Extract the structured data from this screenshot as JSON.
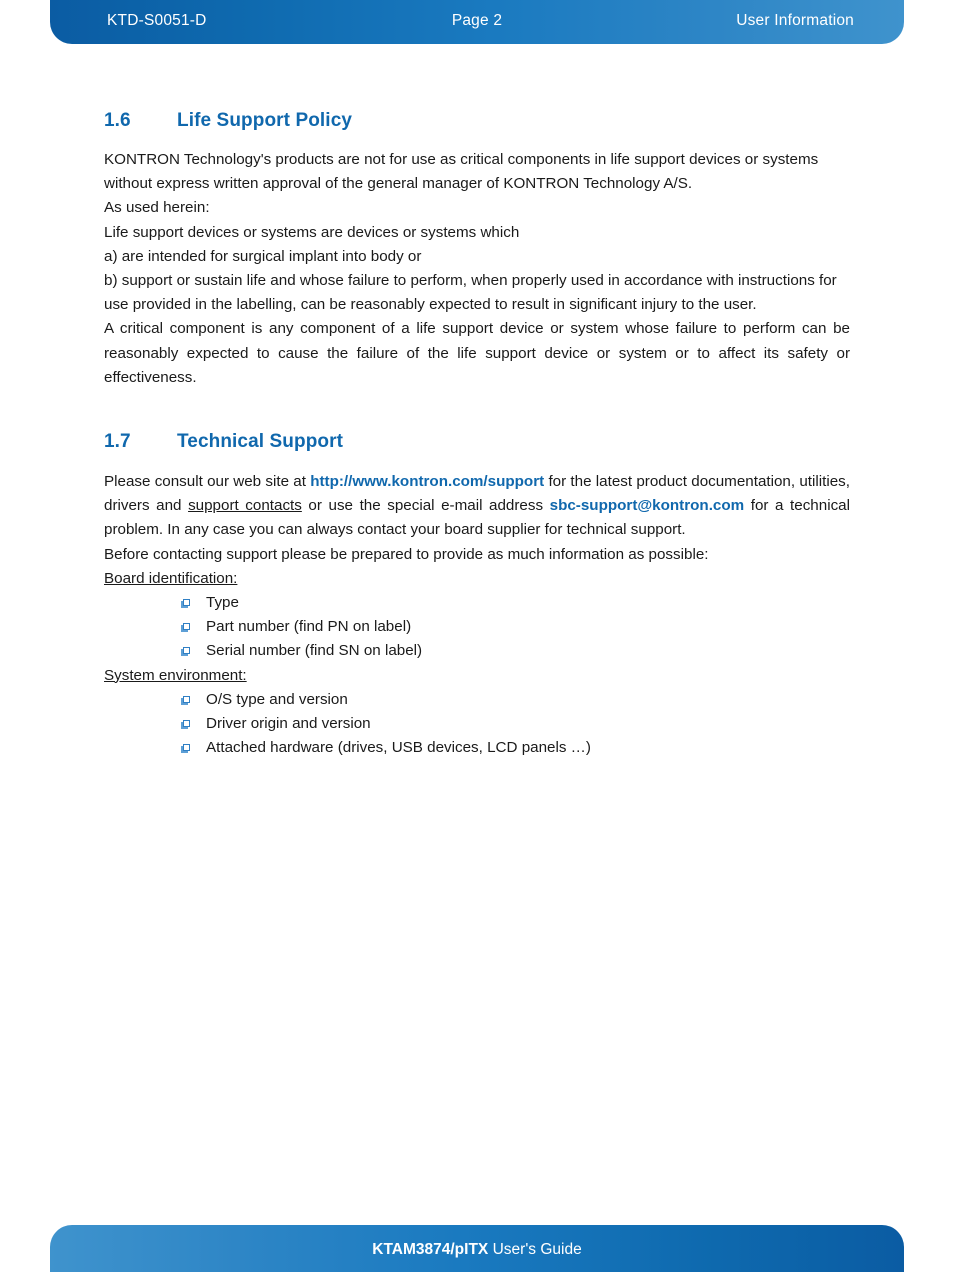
{
  "header": {
    "doc_id": "KTD-S0051-D",
    "page_label": "Page 2",
    "chapter_title": "User Information"
  },
  "footer": {
    "product": "KTAM3874/pITX",
    "guide_label": " User's Guide"
  },
  "colors": {
    "accent_blue": "#1068ad",
    "band_dark": "#0b5ca3",
    "band_light": "#3f93cd",
    "bullet_blue": "#2f7fc4",
    "text": "#1a1a1a"
  },
  "sections": [
    {
      "number": "1.6",
      "title": "Life Support Policy",
      "paragraphs": [
        "KONTRON Technology's products are not for use as critical components in life support devices or systems without express written approval of the general manager of KONTRON Technology A/S.",
        "As used herein:",
        "Life support devices or systems are devices or systems which",
        "a) are intended for surgical implant into body or",
        "b) support or sustain life and whose failure to perform, when properly used in accordance with instructions for use provided in the labelling, can be reasonably expected to result in significant injury to the user.",
        "A critical component is any component of a life support device or system whose failure to perform can be reasonably expected to cause the failure of the life support device or system or to affect its safety or effectiveness."
      ]
    },
    {
      "number": "1.7",
      "title": "Technical Support",
      "intro": {
        "part1": "Please consult our web site at ",
        "web_link": "http://www.kontron.com/support",
        "part2": " for the latest product documentation, utilities, drivers and ",
        "support_contacts": "support contacts",
        "part3": " or use the special e-mail address ",
        "email_link": "sbc-support@kontron.com",
        "part4": " for a technical problem. In any case you can always contact your board supplier for technical support."
      },
      "prepare_line": "Before contacting support please be prepared to provide as much information as possible:",
      "groups": [
        {
          "label": "Board identification:",
          "items": [
            "Type",
            "Part number (find PN on label)",
            "Serial number (find SN on label)"
          ]
        },
        {
          "label": "System environment:",
          "items": [
            "O/S type and version",
            "Driver origin and version",
            "Attached hardware (drives, USB devices, LCD panels …)"
          ]
        }
      ]
    }
  ]
}
